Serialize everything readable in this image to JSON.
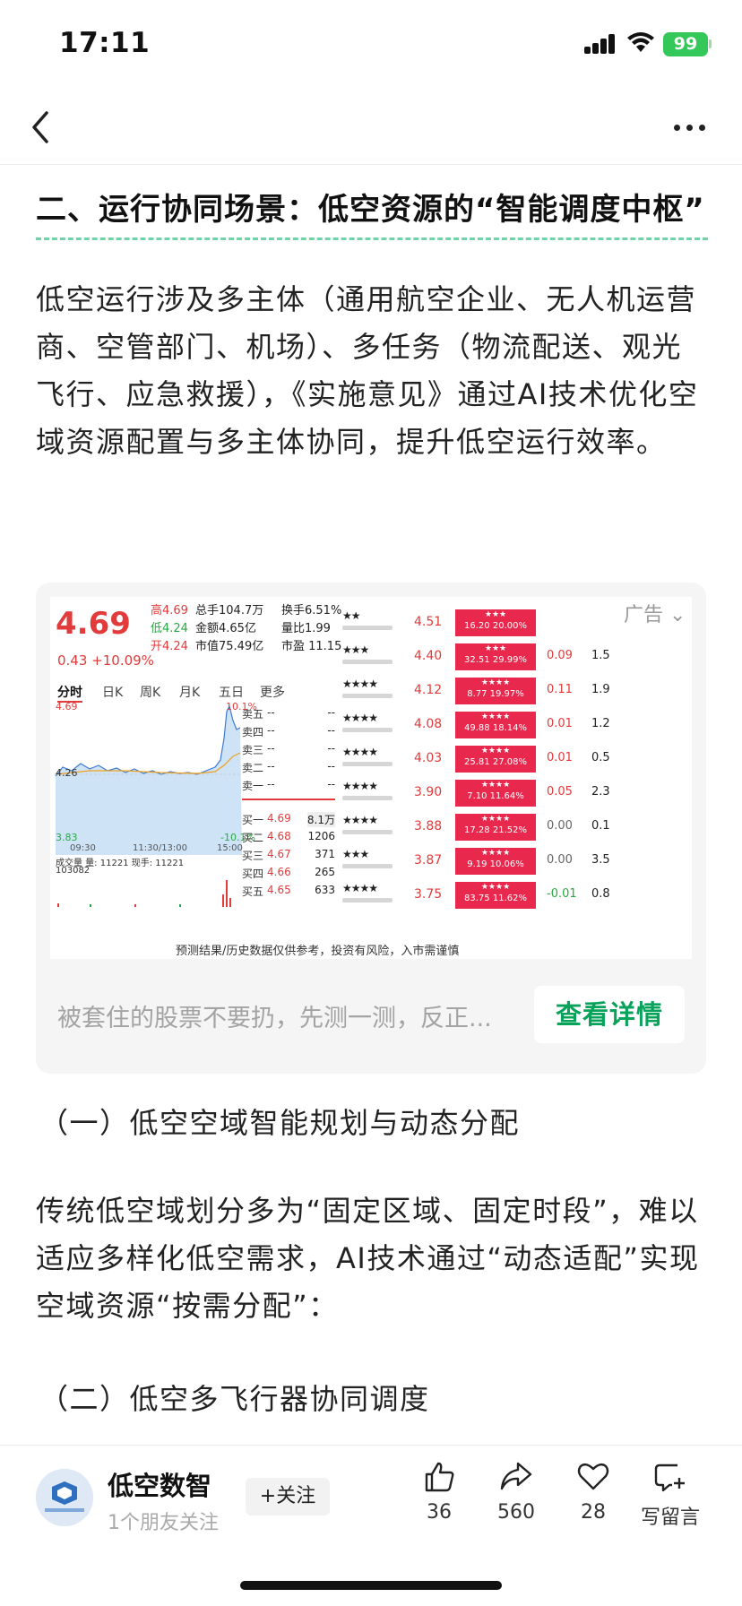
{
  "status_bar": {
    "time": "17:11",
    "battery": "99"
  },
  "article": {
    "section_heading": "二、运行协同场景：低空资源的“智能调度中枢”",
    "paragraph1": "低空运行涉及多主体（通用航空企业、无人机运营商、空管部门、机场）、多任务（物流配送、观光飞行、应急救援），《实施意见》通过AI技术优化空域资源配置与多主体协同，提升低空运行效率。",
    "subheading1": "（一）低空空域智能规划与动态分配",
    "paragraph2": "传统低空域划分多为“固定区域、固定时段”，难以适应多样化低空需求，AI技术通过“动态适配”实现空域资源“按需分配”：",
    "subheading2": "（二）低空多飞行器协同调度"
  },
  "ad": {
    "tag": "广告",
    "text": "被套住的股票不要扔，先测一测，反正...",
    "button": "查看详情",
    "quote": {
      "price": "4.69",
      "change": "0.43 +10.09%",
      "high": "高4.69",
      "low": "低4.24",
      "open": "开4.24",
      "total_hand": "总手104.7万",
      "amount": "金额4.65亿",
      "mktcap": "市值75.49亿",
      "turnover": "换手6.51%",
      "vol_ratio": "量比1.99",
      "pe": "市盈 11.15",
      "tabs": [
        "分时",
        "日K",
        "周K",
        "月K",
        "五日",
        "更多"
      ],
      "chart_high": "4.69",
      "chart_high_pct": "10.1%",
      "chart_mid": "4.26",
      "chart_low": "3.83",
      "chart_low_pct": "-10.1%",
      "times": [
        "09:30",
        "11:30/13:00",
        "15:00"
      ],
      "volume_line": "成交量 量: 11221 现手: 11221",
      "volume_num": "103082",
      "asks": [
        {
          "label": "卖五",
          "price": "--",
          "vol": "--"
        },
        {
          "label": "卖四",
          "price": "--",
          "vol": "--"
        },
        {
          "label": "卖三",
          "price": "--",
          "vol": "--"
        },
        {
          "label": "卖二",
          "price": "--",
          "vol": "--"
        },
        {
          "label": "卖一",
          "price": "--",
          "vol": "--"
        }
      ],
      "bids": [
        {
          "label": "买一",
          "price": "4.69",
          "vol": "8.1万"
        },
        {
          "label": "买二",
          "price": "4.68",
          "vol": "1206"
        },
        {
          "label": "买三",
          "price": "4.67",
          "vol": "371"
        },
        {
          "label": "买四",
          "price": "4.66",
          "vol": "265"
        },
        {
          "label": "买五",
          "price": "4.65",
          "vol": "633"
        }
      ],
      "footer": "预测结果/历史数据仅供参考，投资有风险，入市需谨慎"
    },
    "rankings": [
      {
        "stars": "★★",
        "price": "4.51",
        "badge_stars": "★★★",
        "badge": "16.20 20.00%",
        "chg": "",
        "extra": ""
      },
      {
        "stars": "★★★",
        "price": "4.40",
        "badge_stars": "★★★",
        "badge": "32.51 29.99%",
        "chg": "0.09",
        "extra": "1.5"
      },
      {
        "stars": "★★★★",
        "price": "4.12",
        "badge_stars": "★★★★",
        "badge": "8.77 19.97%",
        "chg": "0.11",
        "extra": "1.9"
      },
      {
        "stars": "★★★★",
        "price": "4.08",
        "badge_stars": "★★★★",
        "badge": "49.88 18.14%",
        "chg": "0.01",
        "extra": "1.2"
      },
      {
        "stars": "★★★★",
        "price": "4.03",
        "badge_stars": "★★★★",
        "badge": "25.81 27.08%",
        "chg": "0.01",
        "extra": "0.5"
      },
      {
        "stars": "★★★★",
        "price": "3.90",
        "badge_stars": "★★★★",
        "badge": "7.10 11.64%",
        "chg": "0.05",
        "extra": "2.3"
      },
      {
        "stars": "★★★★",
        "price": "3.88",
        "badge_stars": "★★★★",
        "badge": "17.28 21.52%",
        "chg": "0.00",
        "extra": "0.1"
      },
      {
        "stars": "★★★",
        "price": "3.87",
        "badge_stars": "★★★★",
        "badge": "9.19 10.06%",
        "chg": "0.00",
        "extra": "3.5"
      },
      {
        "stars": "★★★★",
        "price": "3.75",
        "badge_stars": "★★★★",
        "badge": "83.75 11.62%",
        "chg": "-0.01",
        "extra": "0.8"
      }
    ]
  },
  "author": {
    "name": "低空数智",
    "sub": "1个朋友关注",
    "follow": "+关注"
  },
  "actions": [
    {
      "icon": "thumbs-up-icon",
      "count": "36"
    },
    {
      "icon": "share-icon",
      "count": "560"
    },
    {
      "icon": "heart-icon",
      "count": "28"
    },
    {
      "icon": "comment-icon",
      "count": "写留言"
    }
  ],
  "colors": {
    "accent_green": "#07a35a",
    "stock_red": "#e23b3b",
    "badge_red": "#e8284d",
    "dashed_underline": "#6fd3a7"
  }
}
